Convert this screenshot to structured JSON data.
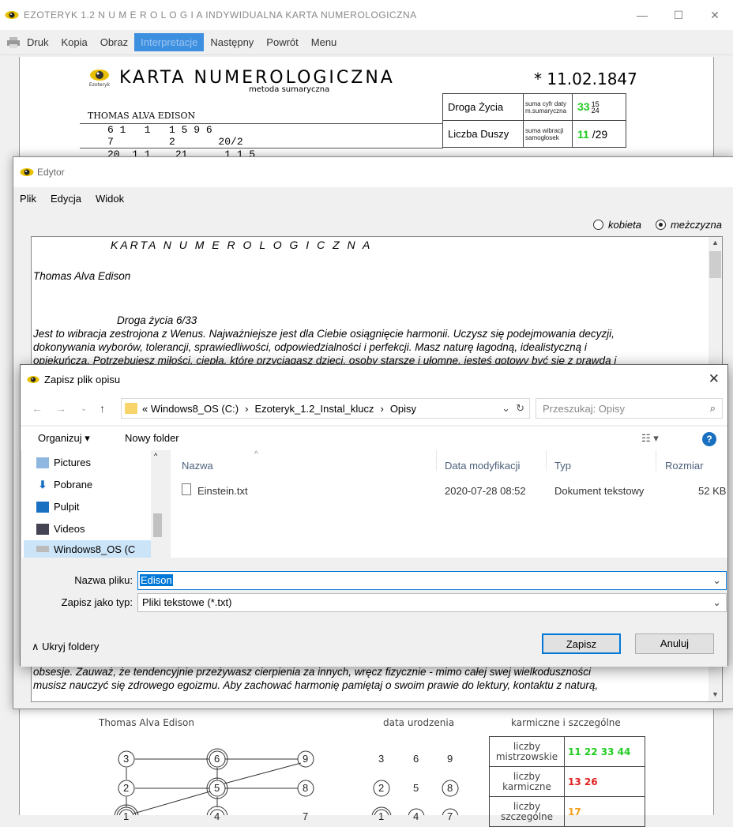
{
  "main": {
    "title": "EZOTERYK 1.2    N U M E R O L O G I A    INDYWIDUALNA KARTA NUMEROLOGICZNA",
    "menu": [
      "Druk",
      "Kopia",
      "Obraz",
      "Interpretacje",
      "Następny",
      "Powrót",
      "Menu"
    ],
    "card": {
      "heading": "KARTA NUMEROLOGICZNA",
      "subheading": "metoda sumaryczna",
      "date": "* 11.02.1847",
      "name": "THOMAS ALVA EDISON",
      "digits_row1": "6 1   1   1 5 9 6",
      "digits_row2": "7         2       20/2",
      "digits_row3": "20  1 1    21      1 1 5",
      "rows": [
        {
          "label": "Droga Życia",
          "sub1": "suma cyfr daty",
          "sub2": "m.sumaryczna",
          "main": "33",
          "sup": "15",
          "subs": "24"
        },
        {
          "label": "Liczba Duszy",
          "sub1": "suma wibracji",
          "sub2": "samogłosek",
          "main": "11",
          "rest": "/29"
        }
      ],
      "graph_label": "Thomas Alva Edison",
      "birth_label": "data urodzenia",
      "karmic_label": "karmiczne i szczególne",
      "birth_grid": [
        "3",
        "6",
        "9",
        "2",
        "5",
        "8",
        "1",
        "4",
        "7"
      ],
      "name_grid": [
        "3",
        "6",
        "9",
        "2",
        "5",
        "8",
        "1",
        "4",
        "7"
      ],
      "karmic": [
        {
          "label1": "liczby",
          "label2": "mistrzowskie",
          "value": "11 22 33 44",
          "color": "#22cc22"
        },
        {
          "label1": "liczby",
          "label2": "karmiczne",
          "value": "13 26",
          "color": "#e02020"
        },
        {
          "label1": "liczby",
          "label2": "szczególne",
          "value": "17",
          "color": "#f0a020"
        }
      ]
    }
  },
  "editor": {
    "title": "Edytor",
    "menu": [
      "Plik",
      "Edycja",
      "Widok"
    ],
    "radio_female": "kobieta",
    "radio_male": "meżczyzna",
    "lines": [
      "KARTA  N U M E R O L O G I C Z N A",
      "Thomas  Alva Edison",
      "Droga życia 6/33",
      "  Jest to wibracja zestrojona z Wenus. Najważniejsze jest dla Ciebie osiągnięcie harmonii. Uczysz się podejmowania decyzji,",
      "dokonywania wyborów, tolerancji, sprawiedliwości, odpowiedzialności i perfekcji. Masz naturę łagodną, idealistyczną i",
      "opiekuńczą. Potrzebujesz miłości, ciepła, które przyciągasz dzieci, osoby starsze i ułomne, jesteś gotowy być się z prawdą i",
      "obsesje. Zauważ, że tendencyjnie przeżywasz cierpienia za innych, wręcz fizycznie - mimo całej swej wielkoduszności",
      "musisz nauczyć się zdrowego egoizmu. Aby zachować harmonię pamiętaj o swoim prawie do lektury, kontaktu z naturą,"
    ]
  },
  "dialog": {
    "title": "Zapisz plik opisu",
    "path": [
      "«  Windows8_OS (C:)",
      "›",
      "Ezoteryk_1.2_Instal_klucz",
      "›",
      "Opisy"
    ],
    "search_placeholder": "Przeszukaj: Opisy",
    "organize": "Organizuj ▾",
    "new_folder": "Nowy folder",
    "nav_items": [
      "Pictures",
      "Pobrane",
      "Pulpit",
      "Videos",
      "Windows8_OS (C"
    ],
    "columns": [
      "Nazwa",
      "Data modyfikacji",
      "Typ",
      "Rozmiar"
    ],
    "files": [
      {
        "name": "Einstein.txt",
        "date": "2020-07-28 08:52",
        "type": "Dokument tekstowy",
        "size": "52 KB"
      }
    ],
    "filename_label": "Nazwa pliku:",
    "filename_value": "Edison",
    "filetype_label": "Zapisz jako typ:",
    "filetype_value": "Pliki tekstowe (*.txt)",
    "hide_folders": "Ukryj foldery",
    "save": "Zapisz",
    "cancel": "Anuluj"
  }
}
